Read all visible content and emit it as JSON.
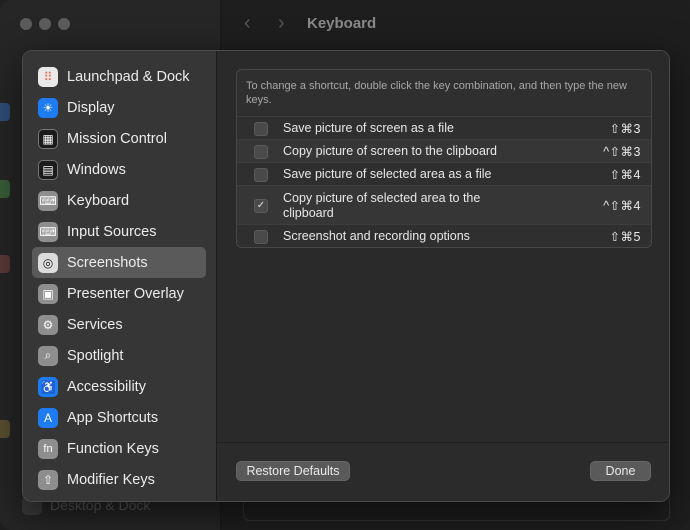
{
  "window": {
    "title": "Keyboard",
    "background_sidebar_item": "Desktop & Dock"
  },
  "sidebar": {
    "items": [
      {
        "label": "Launchpad & Dock",
        "icon": "launchpad-icon",
        "color": "#e9e9e9"
      },
      {
        "label": "Display",
        "icon": "display-icon",
        "color": "#1e7cf2"
      },
      {
        "label": "Mission Control",
        "icon": "mission-control-icon",
        "color": "#1b1b1b"
      },
      {
        "label": "Windows",
        "icon": "windows-icon",
        "color": "#1b1b1b"
      },
      {
        "label": "Keyboard",
        "icon": "keyboard-icon",
        "color": "#8e8e8e"
      },
      {
        "label": "Input Sources",
        "icon": "input-sources-icon",
        "color": "#8e8e8e"
      },
      {
        "label": "Screenshots",
        "icon": "screenshots-icon",
        "color": "#dcdcdc",
        "selected": true
      },
      {
        "label": "Presenter Overlay",
        "icon": "presenter-overlay-icon",
        "color": "#8e8e8e"
      },
      {
        "label": "Services",
        "icon": "services-icon",
        "color": "#8e8e8e"
      },
      {
        "label": "Spotlight",
        "icon": "spotlight-icon",
        "color": "#8e8e8e"
      },
      {
        "label": "Accessibility",
        "icon": "accessibility-icon",
        "color": "#1e7cf2"
      },
      {
        "label": "App Shortcuts",
        "icon": "app-shortcuts-icon",
        "color": "#1e7cf2"
      },
      {
        "label": "Function Keys",
        "icon": "function-keys-icon",
        "color": "#8e8e8e"
      },
      {
        "label": "Modifier Keys",
        "icon": "modifier-keys-icon",
        "color": "#8e8e8e"
      }
    ]
  },
  "panel": {
    "description": "To change a shortcut, double click the key combination, and then type the new keys.",
    "rows": [
      {
        "label": "Save picture of screen as a file",
        "shortcut": "⇧⌘3",
        "checked": false
      },
      {
        "label": "Copy picture of screen to the clipboard",
        "shortcut": "^⇧⌘3",
        "checked": false
      },
      {
        "label": "Save picture of selected area as a file",
        "shortcut": "⇧⌘4",
        "checked": false
      },
      {
        "label": "Copy picture of selected area to the clipboard",
        "shortcut": "^⇧⌘4",
        "checked": true
      },
      {
        "label": "Screenshot and recording options",
        "shortcut": "⇧⌘5",
        "checked": false
      }
    ]
  },
  "buttons": {
    "restore_defaults": "Restore Defaults",
    "done": "Done"
  }
}
